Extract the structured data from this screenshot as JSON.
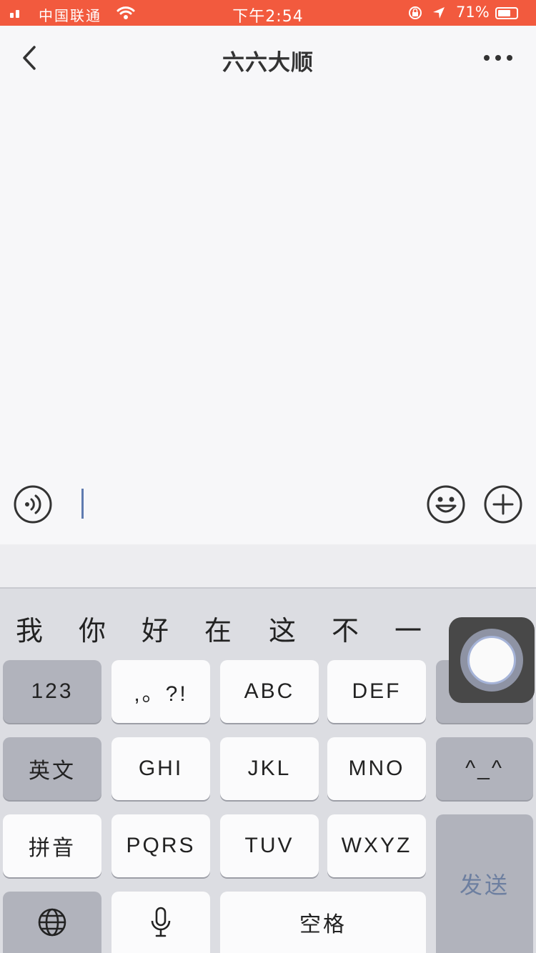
{
  "status_bar": {
    "carrier": "中国联通",
    "time": "下午2:54",
    "battery": "71%",
    "battery_level": 0.71
  },
  "nav": {
    "title": "六六大顺"
  },
  "candidates": [
    "我",
    "你",
    "好",
    "在",
    "这",
    "不",
    "一"
  ],
  "keyboard": {
    "row1": [
      "123",
      ",。?!",
      "ABC",
      "DEF"
    ],
    "row2": [
      "英文",
      "GHI",
      "JKL",
      "MNO",
      "^_^"
    ],
    "row3": [
      "拼音",
      "PQRS",
      "TUV",
      "WXYZ"
    ],
    "space": "空格",
    "send": "发送"
  },
  "colors": {
    "status_bar": "#f25a3e",
    "accent": "#6d7fa0"
  }
}
